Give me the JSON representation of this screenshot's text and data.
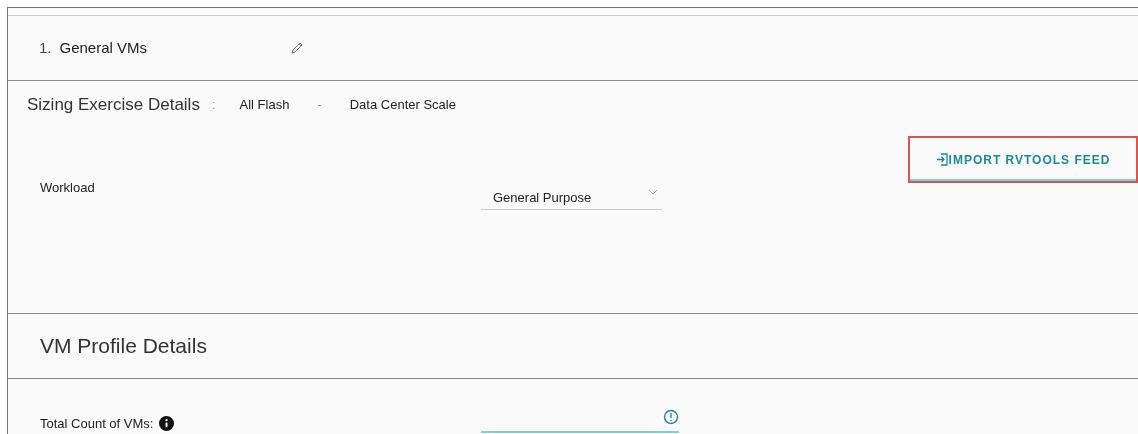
{
  "header": {
    "number": "1.",
    "title": "General VMs"
  },
  "sizing": {
    "title": "Sizing Exercise Details",
    "separator": ":",
    "type": "All Flash",
    "dash": "-",
    "scale": "Data Center Scale",
    "import_button": "IMPORT RVTOOLS FEED"
  },
  "workload": {
    "label": "Workload",
    "value": "General Purpose"
  },
  "vm_profile": {
    "title": "VM Profile Details",
    "fields": [
      {
        "label": "Total Count of VMs:",
        "invalid": true
      }
    ]
  }
}
